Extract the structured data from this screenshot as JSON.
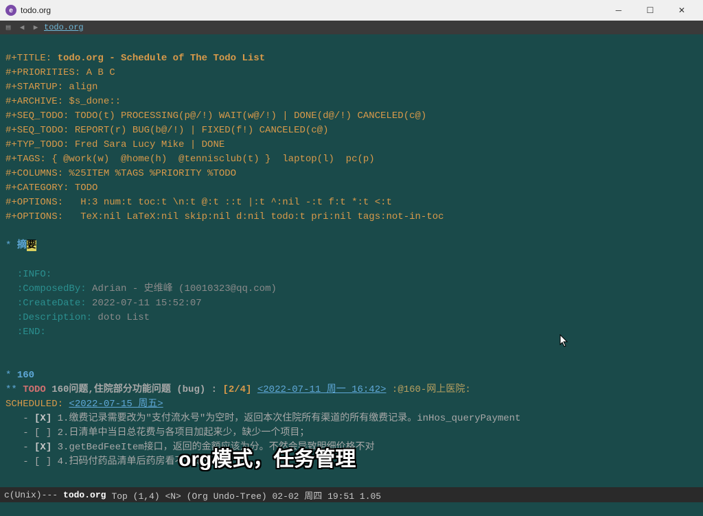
{
  "window": {
    "title": "todo.org"
  },
  "toolbar": {
    "filename": "todo.org"
  },
  "header": {
    "title_key": "#+TITLE: ",
    "title_val": "todo.org - Schedule of The Todo List",
    "priorities": "#+PRIORITIES: A B C",
    "startup": "#+STARTUP: align",
    "archive": "#+ARCHIVE: $s_done::",
    "seq_todo1": "#+SEQ_TODO: TODO(t) PROCESSING(p@/!) WAIT(w@/!) | DONE(d@/!) CANCELED(c@)",
    "seq_todo2": "#+SEQ_TODO: REPORT(r) BUG(b@/!) | FIXED(f!) CANCELED(c@)",
    "typ_todo": "#+TYP_TODO: Fred Sara Lucy Mike | DONE",
    "tags": "#+TAGS: { @work(w)  @home(h)  @tennisclub(t) }  laptop(l)  pc(p)",
    "columns": "#+COLUMNS: %25ITEM %TAGS %PRIORITY %TODO",
    "category": "#+CATEGORY: TODO",
    "options1": "#+OPTIONS:   H:3 num:t toc:t \\n:t @:t ::t |:t ^:nil -:t f:t *:t <:t",
    "options2": "#+OPTIONS:   TeX:nil LaTeX:nil skip:nil d:nil todo:t pri:nil tags:not-in-toc"
  },
  "summary": {
    "star": "* ",
    "title_a": "摘",
    "title_b": "要",
    "info_open": ":INFO:",
    "composed_key": ":ComposedBy:",
    "composed_val": " Adrian - 史维峰 (10010323@qq.com)",
    "created_key": ":CreateDate:",
    "created_val": " 2022-07-11 15:52:07",
    "desc_key": ":Description:",
    "desc_val": " doto List",
    "info_close": ":END:"
  },
  "section160": {
    "h1": "160",
    "h2_star": "** ",
    "todo": "TODO",
    "h2_text": " 160问题,住院部分功能问题 (bug) : ",
    "ratio": "[2/4]",
    "date1": "<2022-07-11 周一 16:42>",
    "tag": ":@160-网上医院:",
    "sched_key": "SCHEDULED:",
    "sched_date": "<2022-07-15 周五>",
    "items": [
      {
        "mark": "[X]",
        "text": " 1.缴费记录需要改为\"支付流水号\"为空时，返回本次住院所有渠道的所有缴费记录。inHos_queryPayment"
      },
      {
        "mark": "[ ]",
        "text": " 2.日清单中当日总花费与各项目加起来少，缺少一个项目；"
      },
      {
        "mark": "[X]",
        "text": " 3.getBedFeeItem接口，返回的金额应该为分。不然会导致明细价格不对"
      },
      {
        "mark": "[ ]",
        "text": " 4.扫码付药品清单后药房看不到记录。"
      }
    ]
  },
  "overlay": "org模式，任务管理",
  "modeline": {
    "left": "c(Unix)---  ",
    "file": "todo.org",
    "mid": "      Top (1,4)    <N>   (Org Undo-Tree) 02-02 周四 19:51 1.05"
  }
}
